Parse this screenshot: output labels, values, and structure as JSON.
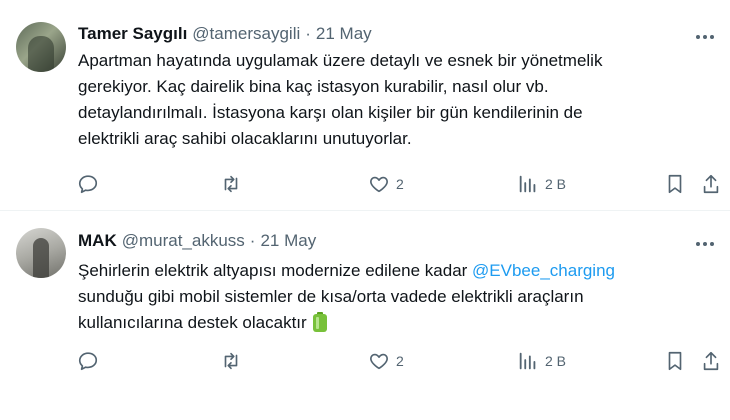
{
  "tweets": [
    {
      "display_name": "Tamer Saygılı",
      "handle": "@tamersaygili",
      "separator": "·",
      "date": "21 May",
      "text_lines": [
        "Apartman hayatında uygulamak üzere detaylı ve esnek bir yönetmelik",
        "gerekiyor. Kaç dairelik bina kaç istasyon kurabilir, nasıl olur vb.",
        "detaylandırılmalı. İstasyona karşı olan kişiler bir gün kendilerinin de",
        "elektrikli araç sahibi olacaklarını unutuyorlar."
      ],
      "replies": "",
      "reposts": "",
      "likes": "2",
      "views": "2 B"
    },
    {
      "display_name": "MAK",
      "handle": "@murat_akkuss",
      "separator": "·",
      "date": "21 May",
      "text_line1_before": "Şehirlerin elektrik altyapısı modernize edilene kadar ",
      "mention": "@EVbee_charging",
      "text_line2": "sunduğu gibi mobil sistemler de kısa/orta vadede elektrikli araçların",
      "text_line3": "kullanıcılarına destek olacaktır",
      "emoji": "battery-icon",
      "replies": "",
      "reposts": "",
      "likes": "2",
      "views": "2 B"
    }
  ],
  "colors": {
    "text": "#0f1419",
    "secondary": "#536471",
    "link": "#1d9bf0",
    "divider": "#eff3f4"
  },
  "icons": [
    "more-icon",
    "reply-icon",
    "retweet-icon",
    "like-icon",
    "views-icon",
    "bookmark-icon",
    "share-icon"
  ]
}
